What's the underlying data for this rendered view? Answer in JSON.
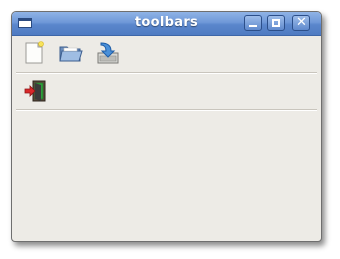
{
  "window": {
    "title": "toolbars",
    "controls": [
      "minimize-icon",
      "maximize-icon",
      "close-icon"
    ]
  },
  "toolbars": [
    {
      "items": [
        {
          "icon": "new-document-icon"
        },
        {
          "icon": "open-folder-icon"
        },
        {
          "icon": "save-icon"
        }
      ]
    },
    {
      "items": [
        {
          "icon": "quit-exit-icon"
        }
      ]
    }
  ],
  "colors": {
    "titlebar": "#5a86cc",
    "window_bg": "#edebe6"
  }
}
